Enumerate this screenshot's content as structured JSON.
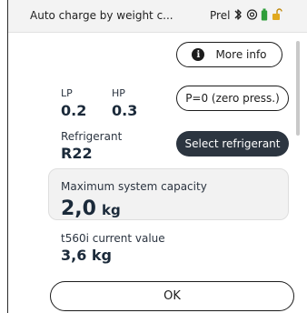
{
  "header": {
    "title": "Auto charge by weight c...",
    "prel": "Prel",
    "icons": [
      "bluetooth-icon",
      "gps-icon",
      "battery-icon",
      "lock-icon"
    ]
  },
  "buttons": {
    "more_info": "More info",
    "zero_press": "P=0 (zero press.)",
    "select_refrigerant": "Select refrigerant",
    "ok": "OK"
  },
  "pressure": {
    "lp_label": "LP",
    "lp_value": "0.2",
    "hp_label": "HP",
    "hp_value": "0.3"
  },
  "refrigerant": {
    "label": "Refrigerant",
    "value": "R22"
  },
  "capacity": {
    "label": "Maximum system capacity",
    "value": "2,0",
    "unit": "kg"
  },
  "current": {
    "label": "t560i current value",
    "value": "3,6 kg"
  },
  "colors": {
    "dark_button": "#2c3540",
    "battery": "#2e9e3a",
    "lock": "#e1a91f",
    "card_bg": "#f2f2f2"
  }
}
